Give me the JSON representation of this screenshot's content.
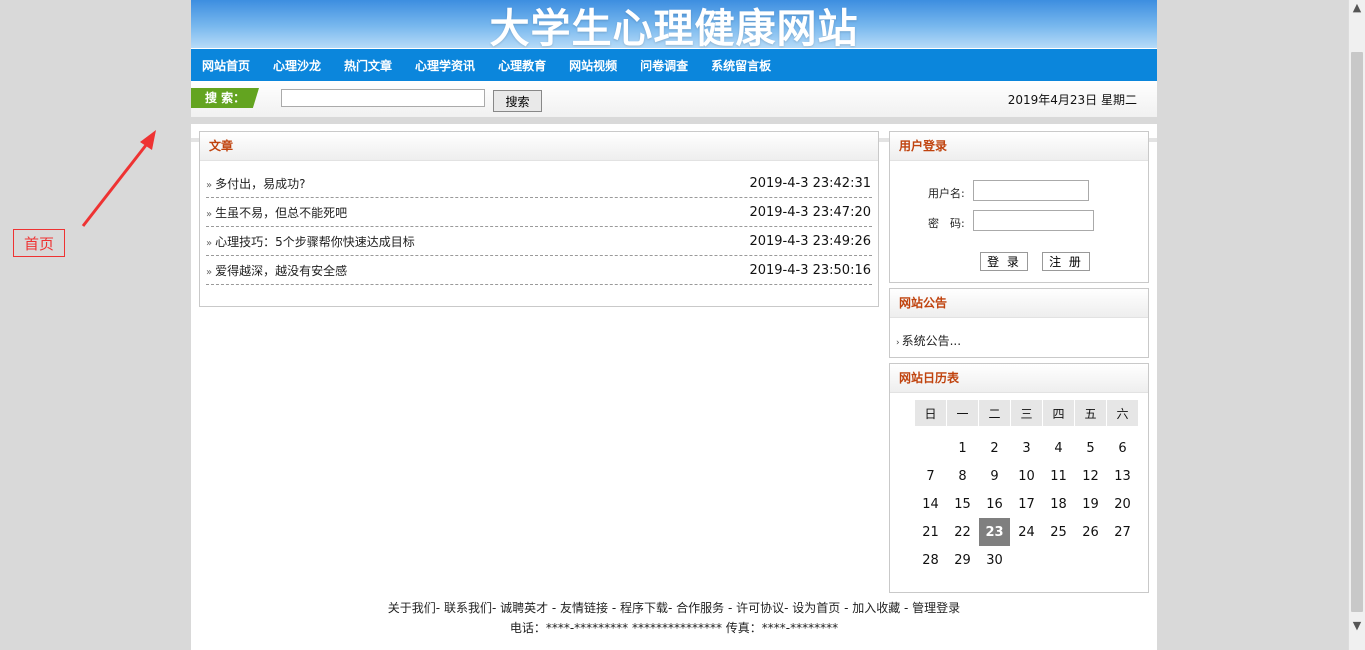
{
  "annotation": {
    "label": "首页"
  },
  "site": {
    "title": "大学生心理健康网站",
    "nav": [
      "网站首页",
      "心理沙龙",
      "热门文章",
      "心理学资讯",
      "心理教育",
      "网站视频",
      "问卷调查",
      "系统留言板"
    ]
  },
  "search": {
    "tag": "搜 索：",
    "value": "",
    "button": "搜索",
    "date": "2019年4月23日 星期二"
  },
  "articles": {
    "heading": "文章",
    "bullet": "»",
    "items": [
      {
        "title": "多付出，易成功?",
        "time": "2019-4-3 23:42:31"
      },
      {
        "title": "生虽不易，但总不能死吧",
        "time": "2019-4-3 23:47:20"
      },
      {
        "title": "心理技巧：5个步骤帮你快速达成目标",
        "time": "2019-4-3 23:49:26"
      },
      {
        "title": "爱得越深，越没有安全感",
        "time": "2019-4-3 23:50:16"
      }
    ]
  },
  "login": {
    "heading": "用户登录",
    "username_label": "用户名:",
    "password_label": "密　码:",
    "login_button": "登 录",
    "register_button": "注 册"
  },
  "notice": {
    "heading": "网站公告",
    "item": "系统公告..."
  },
  "calendar": {
    "heading": "网站日历表",
    "weekdays": [
      "日",
      "一",
      "二",
      "三",
      "四",
      "五",
      "六"
    ],
    "weeks": [
      [
        "",
        "1",
        "2",
        "3",
        "4",
        "5",
        "6"
      ],
      [
        "7",
        "8",
        "9",
        "10",
        "11",
        "12",
        "13"
      ],
      [
        "14",
        "15",
        "16",
        "17",
        "18",
        "19",
        "20"
      ],
      [
        "21",
        "22",
        "23",
        "24",
        "25",
        "26",
        "27"
      ],
      [
        "28",
        "29",
        "30",
        "",
        "",
        "",
        ""
      ]
    ],
    "today": "23"
  },
  "footer": {
    "links": "关于我们- 联系我们- 诚聘英才 - 友情链接 - 程序下载- 合作服务 - 许可协议- 设为首页 - 加入收藏 - 管理登录",
    "contact": "电话：****-********* *************** 传真：****-********"
  }
}
